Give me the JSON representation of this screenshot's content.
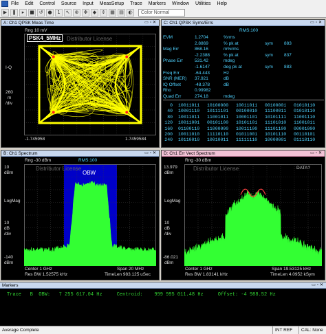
{
  "menu": [
    "File",
    "Edit",
    "Control",
    "Source",
    "Input",
    "MeasSetup",
    "Trace",
    "Markers",
    "Window",
    "Utilities",
    "Help"
  ],
  "toolbar": {
    "color_select": "Color Normal"
  },
  "panelA": {
    "title": "A: Ch1 QPSK Meas Time",
    "rng": "Rng 10 mV",
    "label": "PSK4_5MHz",
    "watermark": "Distributor License",
    "y_label": "I-Q",
    "scale_top": "260",
    "scale_mid": "m",
    "scale_unit": "/div",
    "x_left": "-1.745958",
    "x_right": "1.7459584"
  },
  "panelC": {
    "title": "C: Ch1 QPSK Syms/Errs",
    "rms": "RMS:100",
    "rows": [
      {
        "name": "EVM",
        "v1": "1.2704",
        "u1": "%rms",
        "v2": "",
        "u2": ""
      },
      {
        "name": "",
        "v1": "2.8869",
        "u1": "% pk at",
        "v2": "sym",
        "u2": "883"
      },
      {
        "name": "Mag Err",
        "v1": "868.16",
        "u1": "m%rms",
        "v2": "",
        "u2": ""
      },
      {
        "name": "",
        "v1": "-2.2388",
        "u1": "% pk at",
        "v2": "sym",
        "u2": "837"
      },
      {
        "name": "Phase Err",
        "v1": "531.42",
        "u1": "mdeg",
        "v2": "",
        "u2": ""
      },
      {
        "name": "",
        "v1": "-1.6147",
        "u1": "deg pk at",
        "v2": "sym",
        "u2": "883"
      },
      {
        "name": "Freq Err",
        "v1": "-64.443",
        "u1": "Hz",
        "v2": "",
        "u2": ""
      },
      {
        "name": "SNR (MER)",
        "v1": "37.921",
        "u1": "dB",
        "v2": "",
        "u2": ""
      },
      {
        "name": "IQ Offset",
        "v1": "-48.378",
        "u1": "dB",
        "v2": "",
        "u2": ""
      },
      {
        "name": "Rho",
        "v1": "0.99982",
        "u1": "",
        "v2": "",
        "u2": ""
      },
      {
        "name": "Quad Err",
        "v1": "274.18",
        "u1": "mdeg",
        "v2": "",
        "u2": ""
      }
    ],
    "bits": [
      {
        "idx": "0",
        "b": [
          "10011011",
          "10100000",
          "10011011",
          "00100001",
          "01010110"
        ]
      },
      {
        "idx": "40",
        "b": [
          "10001110",
          "10111101",
          "00100010",
          "11100011",
          "01010110"
        ]
      },
      {
        "idx": "80",
        "b": [
          "10011011",
          "11001011",
          "10001101",
          "10101111",
          "11001110"
        ]
      },
      {
        "idx": "120",
        "b": [
          "10011001",
          "00101100",
          "10101101",
          "11101010",
          "11001011"
        ]
      },
      {
        "idx": "160",
        "b": [
          "01100110",
          "11000000",
          "10011100",
          "11101100",
          "00001000"
        ]
      },
      {
        "idx": "200",
        "b": [
          "10011010",
          "11110110",
          "01011001",
          "10101110",
          "00110101"
        ]
      },
      {
        "idx": "240",
        "b": [
          "10110010",
          "10010011",
          "11111110",
          "10000001",
          "01110110"
        ]
      }
    ]
  },
  "panelB": {
    "title": "B: Ch1 Spectrum",
    "rng": "Rng -30 dBm",
    "rms": "RMS:100",
    "watermark": "Distributor License",
    "obw": "OBW",
    "top_val": "10",
    "top_unit": "dBm",
    "mid_label": "LogMag",
    "div_val": "10",
    "div_unit": "dB",
    "div_sub": "/div",
    "bottom_val": "-140",
    "bottom_unit": "dBm",
    "center": "Center 1 GHz",
    "span": "Span 20 MHz",
    "resbw": "Res BW 1.52575 kHz",
    "timelen": "TimeLen 983.125 uSec"
  },
  "panelD": {
    "title": "D: Ch1 Err Vect Spectrum",
    "rng": "Rng -30 dBm",
    "rms": "RMS:100",
    "watermark": "Distributor License",
    "data_flag": "DATA?",
    "top_val": "13.979",
    "top_unit": "dBm",
    "mid_label": "LogMag",
    "div_val": "10",
    "div_unit": "dB",
    "div_sub": "/div",
    "bottom_val": "-86.021",
    "bottom_unit": "dBm",
    "center": "Center 1 GHz",
    "span": "Span 19.53125 kHz",
    "resbw": "Res BW 1.83141 kHz",
    "timelen": "TimeLen 4.0952 kSym"
  },
  "markers": {
    "title": "Markers",
    "trace_label": "Trace",
    "trace_id": "B",
    "obw_label": "OBW:",
    "obw_value": "7 255 617.04 Hz",
    "centroid_label": "Centroid:",
    "centroid_value": "999 995 011.48 Hz",
    "offset_label": "Offset:",
    "offset_value": "-4 988.52 Hz"
  },
  "status": {
    "left": "Average Complete",
    "intref": "INT REF",
    "cal": "CAL: None"
  },
  "colors": {
    "trace_yellow": "#ffff00",
    "trace_green": "#33ff33",
    "obw_blue": "#0000c8",
    "text_cyan": "#4fd2ff",
    "marker_green": "#33d433"
  }
}
